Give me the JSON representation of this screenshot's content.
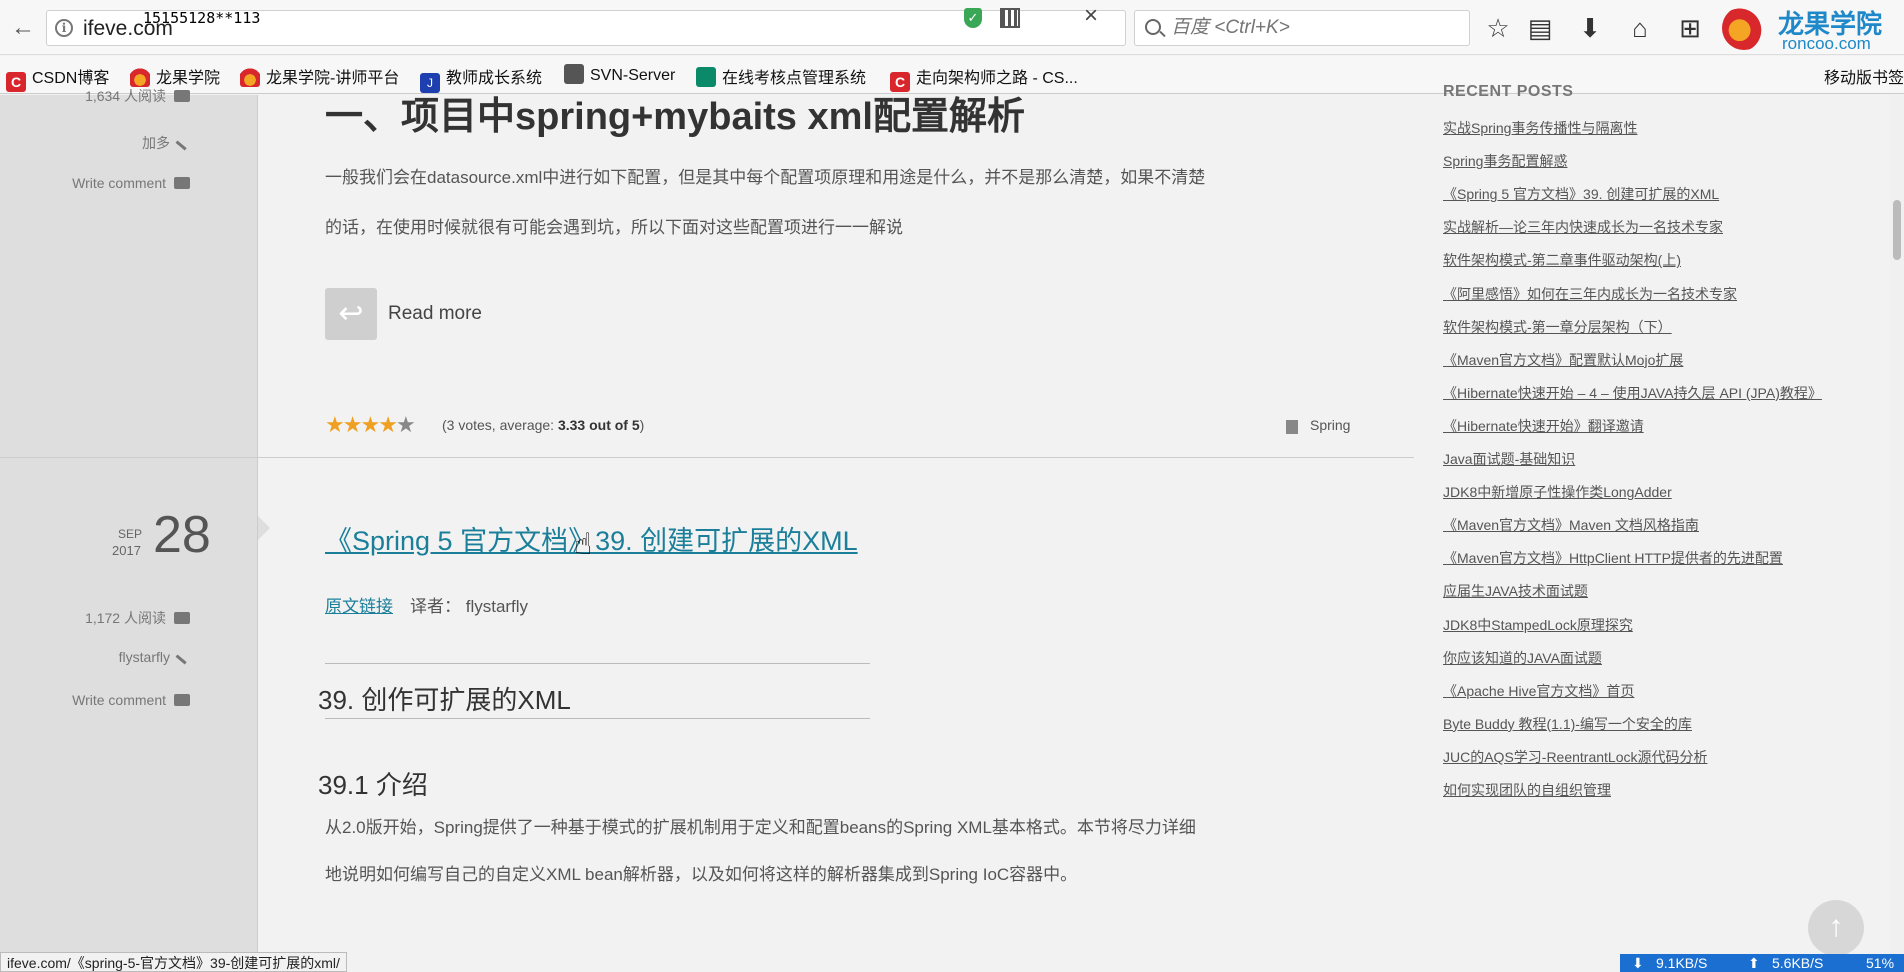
{
  "browser": {
    "url": "ifeve.com",
    "overlay_text": "15155128**113",
    "search_placeholder": "百度 <Ctrl+K>",
    "logo_cn": "龙果学院",
    "logo_en": "roncoo.com"
  },
  "bookmarks": [
    {
      "label": "CSDN博客",
      "icon": "csdn-icon"
    },
    {
      "label": "龙果学院",
      "icon": "roncoo-icon"
    },
    {
      "label": "龙果学院-讲师平台",
      "icon": "roncoo-icon"
    },
    {
      "label": "教师成长系统",
      "icon": "j-icon"
    },
    {
      "label": "SVN-Server",
      "icon": "globe-icon"
    },
    {
      "label": "在线考核点管理系统",
      "icon": "green-icon"
    },
    {
      "label": "走向架构师之路 - CS...",
      "icon": "csdn-icon"
    }
  ],
  "bookmarks_right": "移动版书签",
  "post1": {
    "views": "1,634 人阅读",
    "author": "加多",
    "write_comment": "Write comment",
    "title": "一、项目中spring+mybaits xml配置解析",
    "para_line1": "一般我们会在datasource.xml中进行如下配置，但是其中每个配置项原理和用途是什么，并不是那么清楚，如果不清楚",
    "para_line2": "的话，在使用时候就很有可能会遇到坑，所以下面对这些配置项进行一一解说",
    "read_more": "Read more",
    "rating": {
      "stars": 3.33,
      "max": 5,
      "votes_prefix": "(3 votes, average: ",
      "average": "3.33 out of 5",
      "votes_suffix": ")"
    },
    "category": "Spring"
  },
  "post2": {
    "date_month": "SEP",
    "date_year": "2017",
    "date_day": "28",
    "views": "1,172 人阅读",
    "author": "flystarfly",
    "write_comment": "Write comment",
    "title": "《Spring 5 官方文档》39. 创建可扩展的XML",
    "original_link": "原文链接",
    "translator": "译者： flystarfly",
    "h2": "39. 创作可扩展的XML",
    "h3": "39.1 介绍",
    "body_line1": "从2.0版开始，Spring提供了一种基于模式的扩展机制用于定义和配置beans的Spring XML基本格式。本节将尽力详细",
    "body_line2": "地说明如何编写自己的自定义XML bean解析器，以及如何将这样的解析器集成到Spring IoC容器中。"
  },
  "sidebar": {
    "heading": "RECENT POSTS",
    "posts": [
      "实战Spring事务传播性与隔离性",
      "Spring事务配置解惑",
      "《Spring 5 官方文档》39. 创建可扩展的XML",
      "实战解析—论三年内快速成长为一名技术专家",
      "软件架构模式-第二章事件驱动架构(上)",
      "《阿里感悟》如何在三年内成长为一名技术专家",
      "软件架构模式-第一章分层架构（下）",
      "《Maven官方文档》配置默认Mojo扩展",
      "《Hibernate快速开始 – 4 – 使用JAVA持久层 API (JPA)教程》",
      "《Hibernate快速开始》翻译邀请",
      "Java面试题-基础知识",
      "JDK8中新增原子性操作类LongAdder",
      "《Maven官方文档》Maven 文档风格指南",
      "《Maven官方文档》HttpClient HTTP提供者的先进配置",
      "应届生JAVA技术面试题",
      "JDK8中StampedLock原理探究",
      "你应该知道的JAVA面试题",
      "《Apache Hive官方文档》首页",
      "Byte Buddy 教程(1.1)-编写一个安全的库",
      "JUC的AQS学习-ReentrantLock源代码分析",
      "如何实现团队的自组织管理"
    ]
  },
  "status_url": "ifeve.com/《spring-5-官方文档》39-创建可扩展的xml/",
  "netspeed": {
    "down": "9.1KB/S",
    "up": "5.6KB/S",
    "pct": "51%"
  }
}
